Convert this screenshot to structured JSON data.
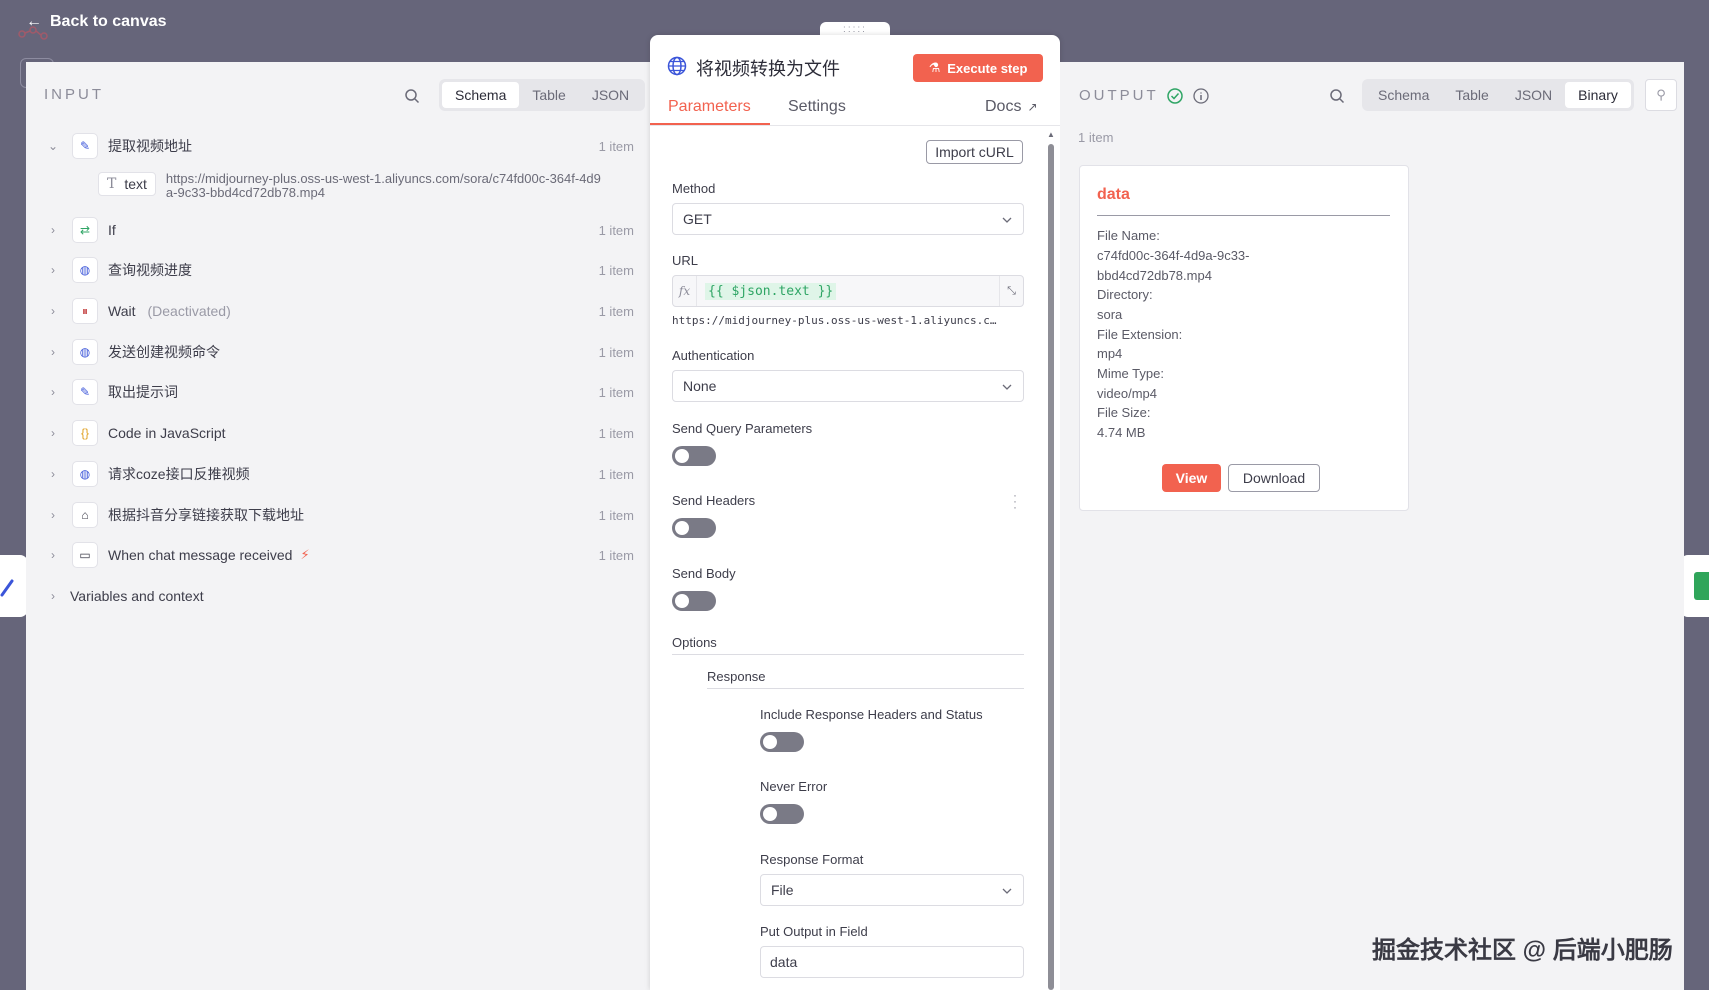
{
  "topbar": {
    "back_label": "Back to canvas"
  },
  "input": {
    "title": "INPUT",
    "tabs": [
      "Schema",
      "Table",
      "JSON"
    ],
    "active_tab": "Schema",
    "nodes": [
      {
        "label": "提取视频地址",
        "count": "1 item",
        "icon": "pencil-icon",
        "expanded": true
      },
      {
        "label": "If",
        "count": "1 item",
        "icon": "branch-icon"
      },
      {
        "label": "查询视频进度",
        "count": "1 item",
        "icon": "globe-icon"
      },
      {
        "label": "Wait",
        "sub": "(Deactivated)",
        "count": "1 item",
        "icon": "pause-icon"
      },
      {
        "label": "发送创建视频命令",
        "count": "1 item",
        "icon": "globe-icon"
      },
      {
        "label": "取出提示词",
        "count": "1 item",
        "icon": "pencil-icon"
      },
      {
        "label": "Code in JavaScript",
        "count": "1 item",
        "icon": "code-icon"
      },
      {
        "label": "请求coze接口反推视频",
        "count": "1 item",
        "icon": "globe-icon"
      },
      {
        "label": "根据抖音分享链接获取下载地址",
        "count": "1 item",
        "icon": "robot-icon"
      },
      {
        "label": "When chat message received",
        "count": "1 item",
        "icon": "chat-icon"
      }
    ],
    "field": {
      "name": "text",
      "value": "https://midjourney-plus.oss-us-west-1.aliyuncs.com/sora/c74fd00c-364f-4d9a-9c33-bbd4cd72db78.mp4"
    },
    "variables_label": "Variables and context"
  },
  "node": {
    "title": "将视频转换为文件",
    "execute_label": "Execute step",
    "tabs": {
      "parameters": "Parameters",
      "settings": "Settings",
      "docs": "Docs"
    },
    "import_curl": "Import cURL",
    "method_label": "Method",
    "method_value": "GET",
    "url_label": "URL",
    "url_fx": "fx",
    "url_expression": "{{ $json.text }}",
    "url_preview": "https://midjourney-plus.oss-us-west-1.aliyuncs.c…",
    "auth_label": "Authentication",
    "auth_value": "None",
    "send_query_label": "Send Query Parameters",
    "send_headers_label": "Send Headers",
    "send_body_label": "Send Body",
    "options_label": "Options",
    "response_label": "Response",
    "include_headers_label": "Include Response Headers and Status",
    "never_error_label": "Never Error",
    "response_format_label": "Response Format",
    "response_format_value": "File",
    "output_field_label": "Put Output in Field",
    "output_field_value": "data"
  },
  "output": {
    "title": "OUTPUT",
    "tabs": [
      "Schema",
      "Table",
      "JSON",
      "Binary"
    ],
    "active_tab": "Binary",
    "count": "1 item",
    "card": {
      "title": "data",
      "file_name_label": "File Name:",
      "file_name_line1": "c74fd00c-364f-4d9a-9c33-",
      "file_name_line2": "bbd4cd72db78.mp4",
      "directory_label": "Directory:",
      "directory_value": "sora",
      "extension_label": "File Extension:",
      "extension_value": "mp4",
      "mime_label": "Mime Type:",
      "mime_value": "video/mp4",
      "size_label": "File Size:",
      "size_value": "4.74 MB",
      "view_label": "View",
      "download_label": "Download"
    }
  },
  "watermark": "掘金技术社区 @ 后端小肥肠",
  "colors": {
    "accent": "#f2624f",
    "success": "#2fa565",
    "backdrop": "#66657a"
  }
}
